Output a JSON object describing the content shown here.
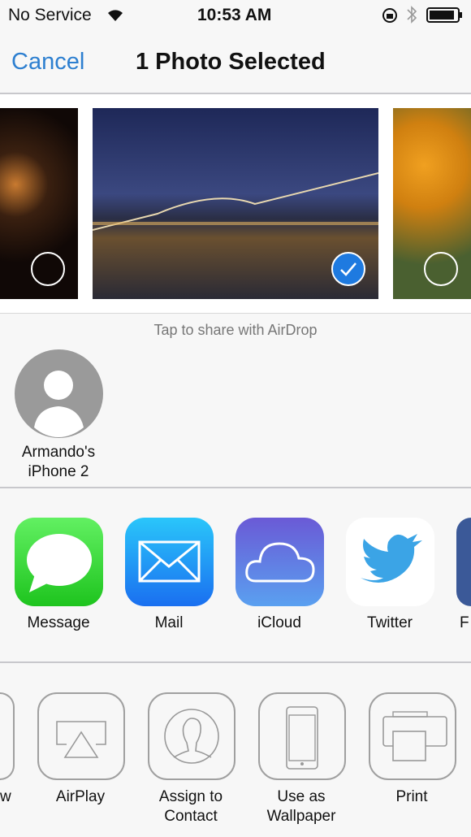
{
  "status": {
    "carrier": "No Service",
    "time": "10:53 AM"
  },
  "nav": {
    "cancel": "Cancel",
    "title": "1 Photo Selected"
  },
  "airdrop": {
    "hint": "Tap to share with AirDrop",
    "device_line1": "Armando's",
    "device_line2": "iPhone 2"
  },
  "apps": [
    {
      "label": "Message",
      "icon": "message-icon"
    },
    {
      "label": "Mail",
      "icon": "mail-icon"
    },
    {
      "label": "iCloud",
      "icon": "icloud-icon"
    },
    {
      "label": "Twitter",
      "icon": "twitter-icon"
    },
    {
      "label": "F",
      "icon": "facebook-icon"
    }
  ],
  "actions": [
    {
      "label": "w",
      "icon": "slideshow-icon"
    },
    {
      "label": "AirPlay",
      "icon": "airplay-icon"
    },
    {
      "label": "Assign to",
      "label2": "Contact",
      "icon": "contact-icon"
    },
    {
      "label": "Use as",
      "label2": "Wallpaper",
      "icon": "wallpaper-icon"
    },
    {
      "label": "Print",
      "icon": "print-icon"
    }
  ],
  "colors": {
    "accent": "#2d7fd0",
    "selected": "#1e7ae0"
  }
}
